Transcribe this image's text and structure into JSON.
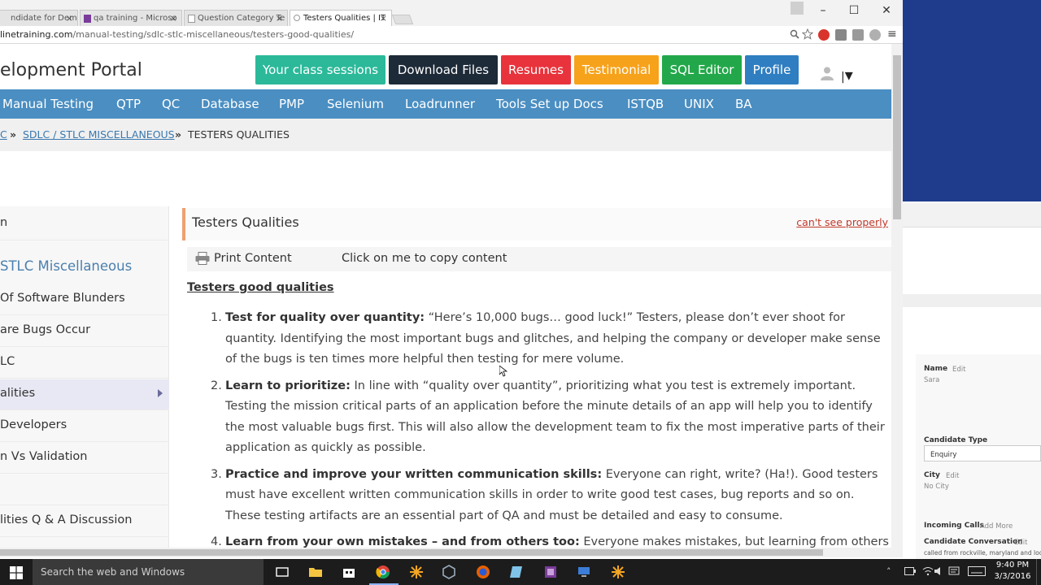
{
  "browser": {
    "tabs": [
      {
        "label": "ndidate for Demo",
        "active": false
      },
      {
        "label": "qa training - Microso",
        "active": false
      },
      {
        "label": "Question Category Te",
        "active": false
      },
      {
        "label": "Testers Qualities | IT",
        "active": true
      }
    ],
    "tab_close": "×",
    "window_controls": {
      "minimize": "–",
      "maximize": "☐",
      "close": "✕"
    },
    "url_host": "linetraining.com",
    "url_path": "/manual-testing/sdlc-stlc-miscellaneous/testers-good-qualities/",
    "menu_glyph": "≡"
  },
  "header": {
    "portal_title": "elopment Portal",
    "buttons": {
      "class_sessions": "Your class sessions",
      "download_files": "Download Files",
      "resumes": "Resumes",
      "testimonial": "Testimonial",
      "sql_editor": "SQL Editor",
      "profile": "Profile"
    },
    "user_separator": "|",
    "caret": "▾"
  },
  "nav": {
    "items": [
      "Manual Testing",
      "QTP",
      "QC",
      "Database",
      "PMP",
      "Selenium",
      "Loadrunner",
      "Tools Set up Docs",
      "ISTQB",
      "UNIX",
      "BA"
    ]
  },
  "breadcrumb": {
    "root": "C",
    "sep": "»",
    "parent": "SDLC / STLC MISCELLANEOUS",
    "current": "TESTERS QUALITIES"
  },
  "sidebar": {
    "top_item": "n",
    "heading": "STLC Miscellaneous",
    "items": [
      {
        "label": "Of Software Blunders",
        "active": false
      },
      {
        "label": "are Bugs Occur",
        "active": false
      },
      {
        "label": "LC",
        "active": false
      },
      {
        "label": "alities",
        "active": true
      },
      {
        "label": "Developers",
        "active": false
      },
      {
        "label": "n Vs Validation",
        "active": false
      },
      {
        "label": "",
        "active": false
      },
      {
        "label": "lities Q & A Discussion",
        "active": false
      }
    ]
  },
  "content": {
    "title": "Testers Qualities",
    "cant_see": "can't see properly",
    "print_label": "Print Content",
    "copy_label": "Click on me to copy content",
    "section_heading": "Testers good qualities",
    "qualities": [
      {
        "num": "1.",
        "title": "Test for quality over quantity:",
        "text": " “Here’s 10,000 bugs… good luck!” Testers, please don’t ever shoot for quantity. Identifying the most important bugs and glitches, and helping the company or developer make sense of the bugs is ten times more helpful then testing for mere volume."
      },
      {
        "num": "2.",
        "title": "Learn to prioritize:",
        "text": " In line with “quality over quantity”, prioritizing what you test is extremely important. Testing the mission critical parts of an application before the minute details of an app will help you to identify the most valuable bugs first. This will also allow the development team to fix the most imperative parts of their application as quickly as possible."
      },
      {
        "num": "3.",
        "title": "Practice and improve your written communication skills:",
        "text": " Everyone can right, write? (Ha!). Good testers must have excellent written communication skills in order to write good test cases, bug reports and so on. These testing artifacts are an essential part of QA and must be detailed and easy to consume."
      },
      {
        "num": "4.",
        "title": "Learn from your own mistakes – and from others too:",
        "text": "  Everyone makes mistakes, but learning from others"
      }
    ]
  },
  "side_window": {
    "name_label": "Name",
    "edit": "Edit",
    "name_value": "Sara",
    "candidate_type_label": "Candidate Type",
    "candidate_type_value": "Enquiry",
    "city_label": "City",
    "city_value": "No City",
    "incoming_calls": "Incoming Calls",
    "add_more": "Add More",
    "conversation_label": "Candidate Conversation",
    "conversation_text": "called from rockville, maryland and lookin"
  },
  "taskbar": {
    "search_placeholder": "Search the web and Windows",
    "time": "9:40 PM",
    "date": "3/3/2016"
  },
  "colors": {
    "nav": "#4a8ec2",
    "class_sessions": "#2bb99a",
    "download_files": "#1d2a38",
    "resumes": "#e8333c",
    "testimonial": "#f7a21b",
    "sql_editor": "#22a84a",
    "profile": "#2f7ec1"
  }
}
